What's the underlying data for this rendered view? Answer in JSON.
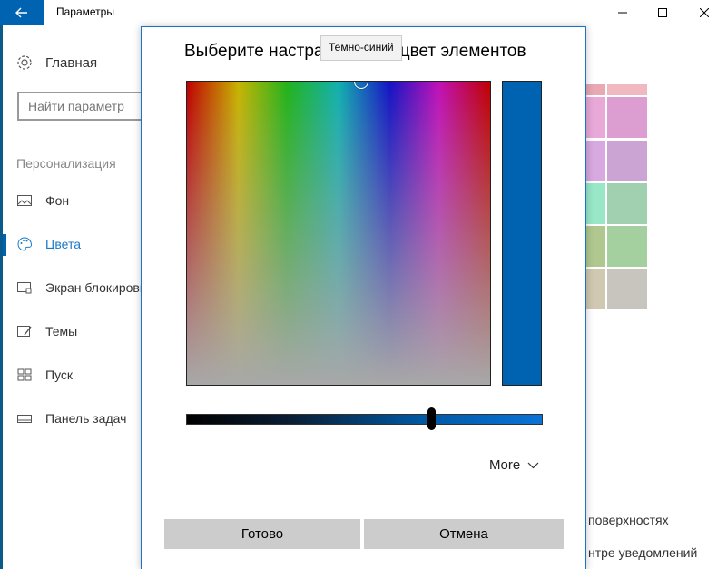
{
  "window": {
    "title": "Параметры",
    "icons": {
      "back": "back-arrow-icon",
      "minimize": "minimize-icon",
      "maximize": "maximize-icon",
      "close": "close-icon"
    }
  },
  "sidebar": {
    "home_label": "Главная",
    "search_placeholder": "Найти параметр",
    "section_title": "Персонализация",
    "items": [
      {
        "label": "Фон",
        "icon": "picture-icon"
      },
      {
        "label": "Цвета",
        "icon": "palette-icon",
        "active": true
      },
      {
        "label": "Экран блокировки",
        "icon": "lock-screen-icon"
      },
      {
        "label": "Темы",
        "icon": "theme-brush-icon"
      },
      {
        "label": "Пуск",
        "icon": "start-grid-icon"
      },
      {
        "label": "Панель задач",
        "icon": "taskbar-icon"
      }
    ]
  },
  "background": {
    "text_surfaces": "поверхностях",
    "text_notifications": "нтре уведомлений"
  },
  "dialog": {
    "title": "Выберите настраиваемый цвет элементов",
    "tooltip": "Темно-синий",
    "preview_color": "#0063b1",
    "more_label": "More",
    "done_label": "Готово",
    "cancel_label": "Отмена"
  },
  "colors": {
    "accent": "#0063b1",
    "button_gray": "#cccccc"
  }
}
